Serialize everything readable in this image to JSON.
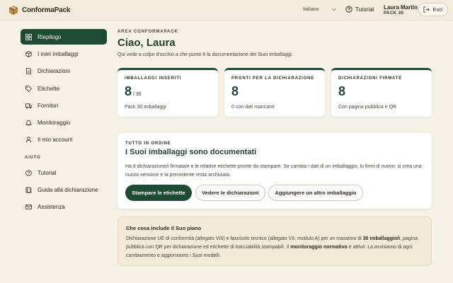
{
  "header": {
    "brand_name": "ConformaPack",
    "language": "Italiano",
    "tutorial_label": "Tutorial",
    "user_name": "Laura Martín",
    "user_plan": "PACK 30",
    "exit_label": "Esci"
  },
  "sidebar": {
    "items": [
      {
        "label": "Riepilogo",
        "icon": "grid-icon",
        "active": true
      },
      {
        "label": "I miei imballaggi",
        "icon": "box-icon",
        "active": false
      },
      {
        "label": "Dichiarazioni",
        "icon": "document-icon",
        "active": false
      },
      {
        "label": "Etichette",
        "icon": "tag-icon",
        "active": false
      },
      {
        "label": "Fornitori",
        "icon": "truck-icon",
        "active": false
      },
      {
        "label": "Monitoraggio",
        "icon": "bell-icon",
        "active": false
      },
      {
        "label": "Il mio account",
        "icon": "user-icon",
        "active": false
      }
    ],
    "help_section": "AIUTO",
    "help_items": [
      {
        "label": "Tutorial",
        "icon": "help-circle-icon"
      },
      {
        "label": "Guida alla dichiarazione",
        "icon": "book-icon"
      },
      {
        "label": "Assistenza",
        "icon": "mail-icon"
      }
    ]
  },
  "main": {
    "area_label": "AREA CONFORMAPACK",
    "greeting": "Ciao, Laura",
    "intro": "Qui vede a colpo d'occhio a che punto è la documentazione dei Suoi imballaggi.",
    "stats": [
      {
        "label": "IMBALLAGGI INSERITI",
        "value": "8",
        "of": "/ 30",
        "sub": "Pack 30 imballaggi"
      },
      {
        "label": "PRONTI PER LA DICHIARAZIONE",
        "value": "8",
        "of": "",
        "sub": "0 con dati mancanti"
      },
      {
        "label": "DICHIARAZIONI FIRMATE",
        "value": "8",
        "of": "",
        "sub": "Con pagina pubblica e QR"
      }
    ],
    "status": {
      "kicker": "TUTTO IN ORDINE",
      "title": "I Suoi imballaggi sono documentati",
      "text": "Ha 8 dichiarazione/i firmata/e e le relative etichette pronte da stampare. Se cambia i dati di un imballaggio, lo firmi di nuovo: si crea una nuova versione e la precedente resta archiviata.",
      "buttons": {
        "primary": "Stampare le etichette",
        "declarations": "Vedere le dichiarazioni",
        "add": "Aggiungere un altro imballaggio"
      }
    },
    "plan": {
      "title": "Che cosa include il Suo piano",
      "text_1": "Dichiarazione UE di conformità (allegato VIII) e fascicolo tecnico (allegato VII, modulo A) per un massimo di ",
      "bold_1": "30 imballaggio/i",
      "text_2": ", pagina pubblica con QR per dichiarazione ed etichette di tracciabilità stampabili. Il ",
      "bold_2": "monitoraggio normativo",
      "text_3": " è attivo: La avvisiamo di ogni cambiamento e aggiorniamo i Suoi modelli."
    }
  },
  "colors": {
    "accent": "#1f4a33",
    "background": "#f6f1e6",
    "plan_background": "#f2e9d6"
  }
}
